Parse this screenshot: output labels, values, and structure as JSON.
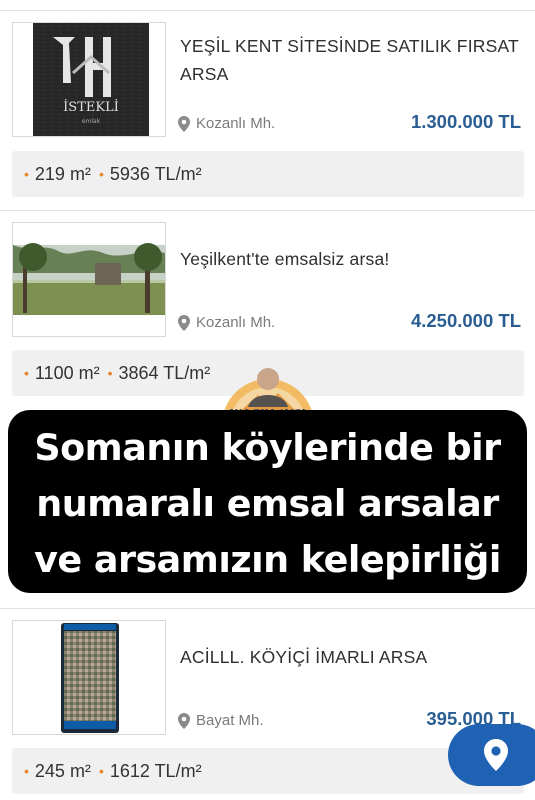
{
  "listings": [
    {
      "title": "YEŞİL KENT SİTESİNDE SATILIK FIRSAT ARSA",
      "location": "Kozanlı Mh.",
      "price": "1.300.000 TL",
      "area": "219 m²",
      "unit_price": "5936 TL/m²",
      "thumb_logo": "İSTEKLİ",
      "thumb_sub": "emlak"
    },
    {
      "title": "Yeşilkent'te emsalsiz arsa!",
      "location": "Kozanlı Mh.",
      "price": "4.250.000 TL",
      "area": "1100 m²",
      "unit_price": "3864 TL/m²"
    },
    {
      "title": "ACİLLL. KÖYİÇİ İMARLI ARSA",
      "location": "Bayat Mh.",
      "price": "395.000 TL",
      "area": "245 m²",
      "unit_price": "1612 TL/m²"
    }
  ],
  "overlay": {
    "line1": "Somanın köylerinde bir",
    "line2": "numaralı emsal arsalar",
    "line3": "ve arsamızın kelepirliği",
    "watermark": "YALÇIN AVCI"
  },
  "icons": {
    "location": "map-pin-icon",
    "fab": "location-pin-icon"
  },
  "colors": {
    "price": "#2a5e93",
    "accent_dot": "#e8852a",
    "fab": "#1f62b3"
  }
}
